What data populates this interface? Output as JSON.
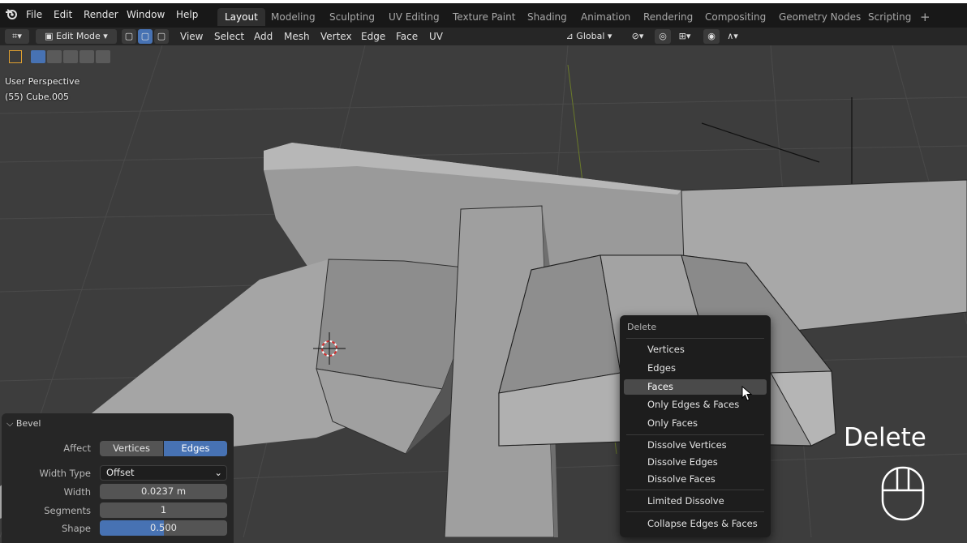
{
  "top_menu": [
    "File",
    "Edit",
    "Render",
    "Window",
    "Help"
  ],
  "workspaces": [
    "Layout",
    "Modeling",
    "Sculpting",
    "UV Editing",
    "Texture Paint",
    "Shading",
    "Animation",
    "Rendering",
    "Compositing",
    "Geometry Nodes",
    "Scripting"
  ],
  "active_workspace": "Layout",
  "add_workspace": "+",
  "header": {
    "mode": "Edit Mode",
    "menus": [
      "View",
      "Select",
      "Add",
      "Mesh",
      "Vertex",
      "Edge",
      "Face",
      "UV"
    ],
    "transform_orientation": "Global"
  },
  "viewport": {
    "perspective": "User Perspective",
    "object": "(55) Cube.005"
  },
  "context_menu": {
    "title": "Delete",
    "items": [
      {
        "label": "Vertices"
      },
      {
        "label": "Edges"
      },
      {
        "label": "Faces",
        "highlighted": true
      },
      {
        "label": "Only Edges & Faces"
      },
      {
        "label": "Only Faces"
      },
      {
        "label": "Dissolve Vertices"
      },
      {
        "label": "Dissolve Edges"
      },
      {
        "label": "Dissolve Faces"
      },
      {
        "label": "Limited Dissolve"
      },
      {
        "label": "Collapse Edges & Faces"
      }
    ]
  },
  "bevel_panel": {
    "title": "Bevel",
    "affect_label": "Affect",
    "affect_options": [
      "Vertices",
      "Edges"
    ],
    "affect_selected": "Edges",
    "width_type_label": "Width Type",
    "width_type_value": "Offset",
    "width_label": "Width",
    "width_value": "0.0237 m",
    "segments_label": "Segments",
    "segments_value": "1",
    "shape_label": "Shape",
    "shape_value": "0.500",
    "shape_fraction": 0.5
  },
  "key_overlay": "Delete",
  "colors": {
    "accent": "#4772b3",
    "menu_bg": "#1d1d1d",
    "topbar_bg": "#181818"
  }
}
